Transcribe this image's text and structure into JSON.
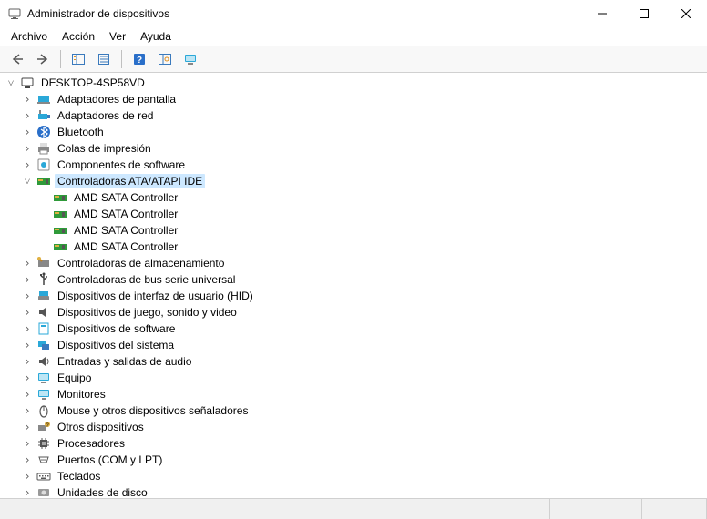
{
  "window": {
    "title": "Administrador de dispositivos"
  },
  "menu": {
    "file": "Archivo",
    "action": "Acción",
    "view": "Ver",
    "help": "Ayuda"
  },
  "root": {
    "name": "DESKTOP-4SP58VD"
  },
  "cat": {
    "display": "Adaptadores de pantalla",
    "net": "Adaptadores de red",
    "bt": "Bluetooth",
    "print": "Colas de impresión",
    "swcomp": "Componentes de software",
    "ata": "Controladoras ATA/ATAPI IDE",
    "storage": "Controladoras de almacenamiento",
    "usb": "Controladoras de bus serie universal",
    "hid": "Dispositivos de interfaz de usuario (HID)",
    "gamesnd": "Dispositivos de juego, sonido y video",
    "swdev": "Dispositivos de software",
    "sysdev": "Dispositivos del sistema",
    "audio": "Entradas y salidas de audio",
    "computer": "Equipo",
    "monitor": "Monitores",
    "mouse": "Mouse y otros dispositivos señaladores",
    "other": "Otros dispositivos",
    "cpu": "Procesadores",
    "ports": "Puertos (COM y LPT)",
    "keyboard": "Teclados",
    "disk": "Unidades de disco"
  },
  "ata_children": {
    "c0": "AMD SATA Controller",
    "c1": "AMD SATA Controller",
    "c2": "AMD SATA Controller",
    "c3": "AMD SATA Controller"
  }
}
